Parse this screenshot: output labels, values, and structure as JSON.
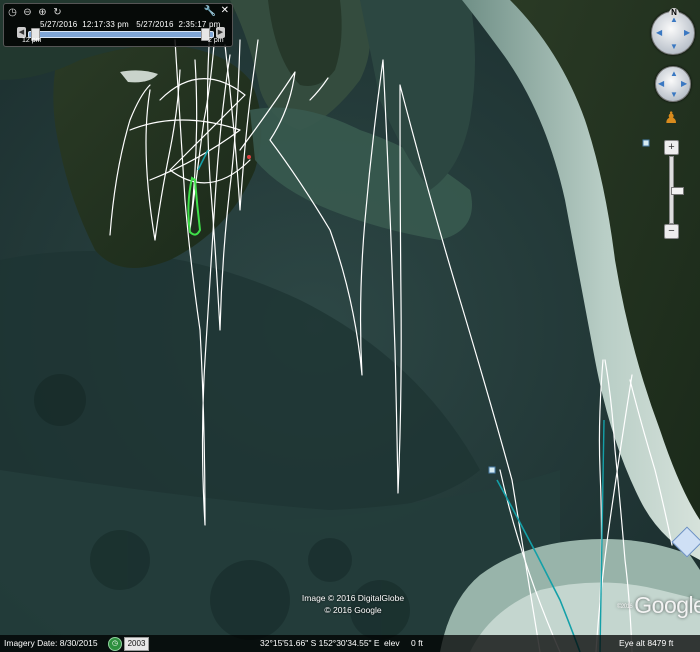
{
  "time_slider": {
    "start_date": "5/27/2016",
    "start_time": "12:17:33 pm",
    "end_date": "5/27/2016",
    "end_time": "2:35:17 pm",
    "left_tick": "12 pm",
    "right_tick": "2 pm",
    "icons": [
      "clock-icon",
      "zoom-out-icon",
      "zoom-in-icon",
      "loop-icon",
      "wrench-icon",
      "close-icon"
    ]
  },
  "navigation": {
    "north_label": "N",
    "icons": [
      "look-ring-icon",
      "move-ring-icon",
      "pegman-icon",
      "zoom-in-icon",
      "zoom-out-icon",
      "zoom-slider-icon"
    ]
  },
  "credit": {
    "line1": "Image © 2016 DigitalGlobe",
    "line2": "© 2016 Google"
  },
  "logo": {
    "year": "©2016",
    "text": "Google"
  },
  "status_bar": {
    "imagery_date": "Imagery Date: 8/30/2015",
    "historic_year": "2003",
    "coordinates": "32°15'51.66\" S  152°30'34.55\" E",
    "elev_label": "elev",
    "elev_value": "0 ft",
    "eye_alt": "Eye alt   8479 ft"
  },
  "colors": {
    "track": "#ffffff",
    "track_highlight": "#3fe04a",
    "track_teal": "#14a0a8",
    "water": "#243a3c",
    "shoal": "#a9c2bb"
  }
}
